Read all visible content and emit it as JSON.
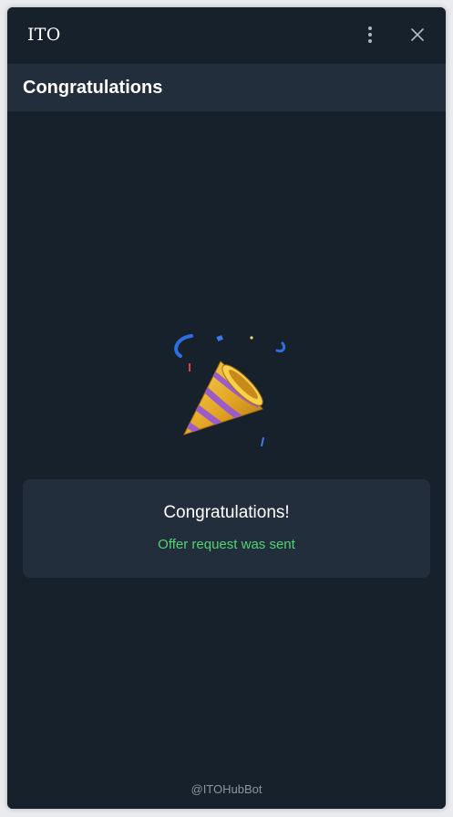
{
  "window": {
    "title": "ITO",
    "menu_icon": "more-vertical-icon",
    "close_icon": "close-icon"
  },
  "header": {
    "title": "Congratulations"
  },
  "main": {
    "illustration": "party-popper-icon",
    "card": {
      "title": "Congratulations!",
      "subtitle": "Offer request was sent"
    }
  },
  "footer": {
    "bot_handle": "@ITOHubBot"
  },
  "colors": {
    "background": "#17212b",
    "header": "#232e3c",
    "card": "#232e3c",
    "success": "#4fd470",
    "muted": "#8a96a3"
  }
}
